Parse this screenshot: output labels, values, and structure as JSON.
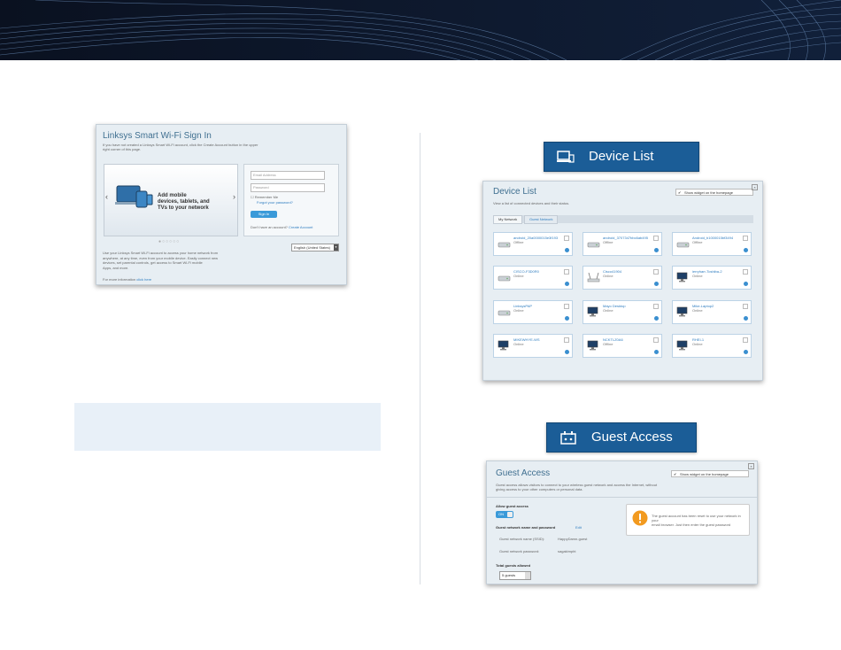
{
  "signin": {
    "title": "Linksys Smart Wi-Fi Sign In",
    "subtitle_1": "If you have not created a Linksys Smart Wi-Fi account, click the Create Account button in the upper",
    "subtitle_2": "right corner of this page.",
    "carousel_text_1": "Add mobile",
    "carousel_text_2": "devices, tablets, and",
    "carousel_text_3": "TVs to your network",
    "email_placeholder": "Email Address",
    "password_placeholder": "Password",
    "remember_me": "Remember Me",
    "forgot_password": "Forgot your password?",
    "sign_in": "Sign In",
    "no_account": "Don't have an account?",
    "create_account": "Create Account",
    "language": "English (United States)",
    "body_1": "Use your Linksys Smart Wi-Fi account to access your home network from",
    "body_2": "anywhere, at any time, even from your mobile device. Easily connect new",
    "body_3": "devices, set parental controls, get access to Smart Wi-Fi mobile",
    "body_4": "Apps, and more.",
    "more_info": "For more information",
    "click_here": "click here"
  },
  "device_list": {
    "header": "Device List",
    "title": "Device List",
    "widget_checkbox": "Show widget on the homepage",
    "description": "View a list of connected devices and their status.",
    "tabs": [
      "My Network",
      "Guest Network"
    ],
    "devices": [
      {
        "name": "android_20a0000015e3f193",
        "status": "Offline",
        "type": "router"
      },
      {
        "name": "android_3707347bbc6ab495",
        "status": "Offline",
        "type": "router"
      },
      {
        "name": "Android_b1000015bf3494",
        "status": "Offline",
        "type": "router"
      },
      {
        "name": "CISCO-F3D0R0",
        "status": "Online",
        "type": "router"
      },
      {
        "name": "Cisco41904",
        "status": "Online",
        "type": "ap"
      },
      {
        "name": "ierryharr-Toshiba-2",
        "status": "Online",
        "type": "desktop"
      },
      {
        "name": "LinksysPAP",
        "status": "Online",
        "type": "router"
      },
      {
        "name": "Mayo Desktop",
        "status": "Online",
        "type": "desktop"
      },
      {
        "name": "Mike-Laptop2",
        "status": "Online",
        "type": "desktop"
      },
      {
        "name": "MIKEWHYE-WS",
        "status": "Online",
        "type": "desktop"
      },
      {
        "name": "NCKTLZ0A6",
        "status": "Offline",
        "type": "desktop"
      },
      {
        "name": "RHEI-1",
        "status": "Online",
        "type": "desktop"
      }
    ]
  },
  "guest_access": {
    "header": "Guest Access",
    "title": "Guest Access",
    "widget_checkbox": "Show widget on the homepage",
    "description_1": "Guest access allows visitors to connect to your wireless guest network and access the Internet, without",
    "description_2": "giving access to your other computers or personal data.",
    "allow_label": "Allow guest access",
    "toggle": "ON",
    "network_label": "Guest network name and password",
    "edit": "Edit",
    "ssid_label": "Guest network name (SSID):",
    "ssid_value": "HappyDamn-guest",
    "password_label": "Guest network password:",
    "password_value": "sagakimpht",
    "warning_1": "The guest account has been reset to use your network in your",
    "warning_2": "email browser. Just then enter the guest password",
    "total_label": "Total guests allowed",
    "total_value": "5 guests"
  },
  "colors": {
    "banner": "#0b1426",
    "header_button": "#1b5d97",
    "link": "#2f7dc0",
    "note_box": "#e8f0f8"
  }
}
